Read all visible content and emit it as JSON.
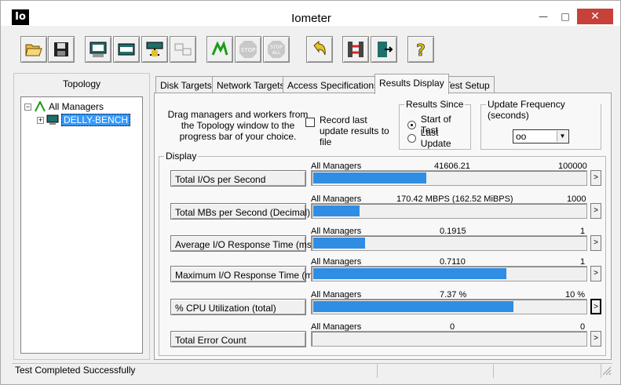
{
  "window": {
    "title": "Iometer",
    "app_icon_text": "Io",
    "minimize_glyph": "—",
    "maximize_glyph": "□",
    "close_glyph": "✕"
  },
  "toolbar": [
    "open-icon",
    "save-icon",
    "display-results-icon",
    "start-disk-workers-icon",
    "start-network-workers-icon",
    "disconnect-icon",
    "start-test-icon",
    "stop-icon",
    "stop-all-icon",
    "reset-workers-icon",
    "manager-icon",
    "exit-icon",
    "help-icon"
  ],
  "toolbar_labels": {
    "stop": "STOP",
    "stop_all_1": "STOP",
    "stop_all_2": "ALL",
    "help": "?"
  },
  "topology": {
    "title": "Topology",
    "root": "All Managers",
    "manager": "DELLY-BENCH"
  },
  "tabs": [
    "Disk Targets",
    "Network Targets",
    "Access Specifications",
    "Results Display",
    "Test Setup"
  ],
  "active_tab": "Results Display",
  "instructions": "Drag managers and workers from the Topology window to the progress bar of your choice.",
  "record_label": "Record last update results to file",
  "results_since": {
    "title": "Results Since",
    "options": [
      "Start of Test",
      "Last Update"
    ],
    "selected": "Start of Test"
  },
  "update_frequency": {
    "title": "Update Frequency (seconds)",
    "value": "oo"
  },
  "display": {
    "title": "Display",
    "metrics": [
      {
        "label": "Total I/Os per Second",
        "source": "All Managers",
        "value": "41606.21",
        "max": "100000",
        "fill": 0.416
      },
      {
        "label": "Total MBs per Second (Decimal)",
        "source": "All Managers",
        "value": "170.42 MBPS (162.52 MiBPS)",
        "max": "1000",
        "fill": 0.17
      },
      {
        "label": "Average I/O Response Time (ms)",
        "source": "All Managers",
        "value": "0.1915",
        "max": "1",
        "fill": 0.19
      },
      {
        "label": "Maximum I/O Response Time (ms)",
        "source": "All Managers",
        "value": "0.7110",
        "max": "1",
        "fill": 0.711
      },
      {
        "label": "% CPU Utilization (total)",
        "source": "All Managers",
        "value": "7.37 %",
        "max": "10 %",
        "fill": 0.737
      },
      {
        "label": "Total Error Count",
        "source": "All Managers",
        "value": "0",
        "max": "0",
        "fill": 0
      }
    ],
    "more_glyph": ">"
  },
  "status": {
    "text": "Test Completed Successfully"
  }
}
